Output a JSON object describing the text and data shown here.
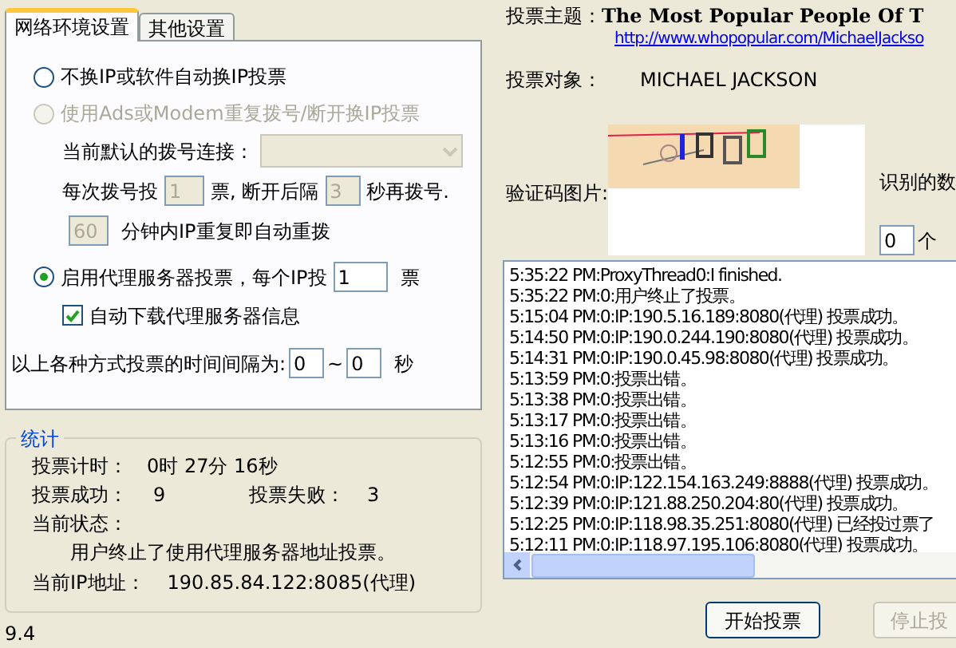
{
  "tabs": [
    {
      "label": "网络环境设置",
      "selected": true
    },
    {
      "label": "其他设置",
      "selected": false
    }
  ],
  "mode_options": [
    {
      "label": "不换IP或软件自动换IP投票",
      "selected": false,
      "disabled": false
    },
    {
      "label": "使用Ads或Modem重复拨号/断开换IP投票",
      "selected": false,
      "disabled": true
    }
  ],
  "dial": {
    "connection_label": "当前默认的拨号连接：",
    "per_dial_label": "每次拨号投",
    "per_dial_value": "1",
    "per_dial_unit": "票, 断开后隔",
    "redial_value": "3",
    "redial_unit": "秒再拨号.",
    "repeat_value": "60",
    "repeat_label": "分钟内IP重复即自动重拨"
  },
  "proxy_option": {
    "label": "启用代理服务器投票，每个IP投",
    "selected": true,
    "value": "1",
    "unit": "票"
  },
  "auto_download": {
    "label": "自动下载代理服务器信息",
    "checked": true
  },
  "interval": {
    "label": "以上各种方式投票的时间间隔为:",
    "from": "0",
    "sep": "~",
    "to": "0",
    "unit": "秒"
  },
  "stats": {
    "title": "统计",
    "timer_label": "投票计时：",
    "timer_value": "0时 27分 16秒",
    "success_label": "投票成功：",
    "success_value": "9",
    "fail_label": "投票失败：",
    "fail_value": "3",
    "status_label": "当前状态：",
    "status_value": "用户终止了使用代理服务器地址投票。",
    "ip_label": "当前IP地址：",
    "ip_value": "190.85.84.122:8085(代理)"
  },
  "version": "9.4",
  "subject": {
    "label": "投票主题：",
    "value": "The Most Popular People Of T",
    "url": "http://www.whopopular.com/MichaelJackso"
  },
  "target": {
    "label": "投票对象：",
    "value": "MICHAEL JACKSON"
  },
  "captcha": {
    "label": "验证码图片:",
    "recognized_label": "识别的数",
    "count_value": "0",
    "count_unit": "个"
  },
  "log": [
    "5:35:22 PM:ProxyThread0:I finished.",
    "5:35:22 PM:0:用户终止了投票。",
    "5:15:04 PM:0:IP:190.5.16.189:8080(代理) 投票成功。",
    "5:14:50 PM:0:IP:190.0.244.190:8080(代理) 投票成功。",
    "5:14:31 PM:0:IP:190.0.45.98:8080(代理) 投票成功。",
    "5:13:59 PM:0:投票出错。",
    "5:13:38 PM:0:投票出错。",
    "5:13:17 PM:0:投票出错。",
    "5:13:16 PM:0:投票出错。",
    "5:12:55 PM:0:投票出错。",
    "5:12:54 PM:0:IP:122.154.163.249:8888(代理) 投票成功。",
    "5:12:39 PM:0:IP:121.88.250.204:80(代理) 投票成功。",
    "5:12:25 PM:0:IP:118.98.35.251:8080(代理) 已经投过票了",
    "5:12:11 PM:0:IP:118.97.195.106:8080(代理) 投票成功。"
  ],
  "buttons": [
    {
      "label": "开始投票",
      "disabled": false
    },
    {
      "label": "停止投",
      "disabled": true
    }
  ]
}
